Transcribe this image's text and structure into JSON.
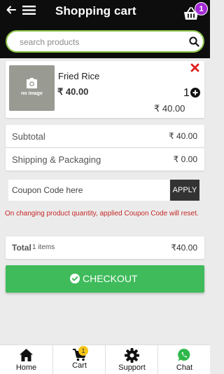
{
  "header": {
    "title": "Shopping cart",
    "cart_badge": "1",
    "icons": {
      "back": "arrow-left-icon",
      "menu": "hamburger-menu-icon",
      "cart": "shopping-basket-icon"
    }
  },
  "search": {
    "placeholder": "search products",
    "value": ""
  },
  "cart_item": {
    "image_label": "no image",
    "name": "Fried Rice",
    "price": "₹ 40.00",
    "quantity": "1",
    "total": "₹ 40.00"
  },
  "summary": {
    "subtotal_label": "Subtotal",
    "subtotal_value": "₹ 40.00",
    "shipping_label": "Shipping & Packaging",
    "shipping_value": "₹ 0.00"
  },
  "coupon": {
    "placeholder": "Coupon Code here",
    "value": "",
    "apply_label": "APPLY",
    "note": "On changing product quantity, applied Coupon Code will reset."
  },
  "total": {
    "label": "Total",
    "items": "1 items",
    "value": "₹40.00"
  },
  "checkout": {
    "label": "CHECKOUT"
  },
  "nav": {
    "home": "Home",
    "cart": "Cart",
    "cart_badge": "1",
    "support": "Support",
    "chat": "Chat"
  },
  "colors": {
    "header_bg": "#0d0d0d",
    "accent_green": "#8bc34a",
    "checkout_green": "#3fbb5b",
    "badge_purple": "#a52ad6",
    "badge_yellow": "#f5c518",
    "remove_red": "#e02020",
    "note_red": "#c62828"
  }
}
